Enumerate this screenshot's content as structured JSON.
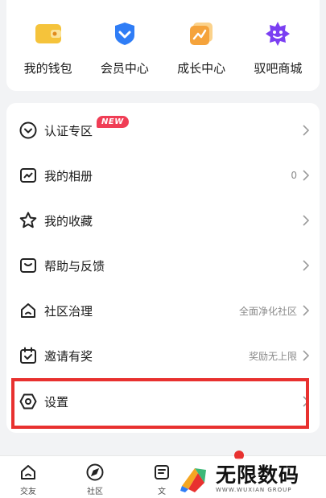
{
  "quick_entries": [
    {
      "label": "我的钱包",
      "icon": "wallet-icon"
    },
    {
      "label": "会员中心",
      "icon": "member-icon"
    },
    {
      "label": "成长中心",
      "icon": "growth-icon"
    },
    {
      "label": "驭吧商城",
      "icon": "mall-icon"
    }
  ],
  "menu": {
    "items": [
      {
        "label": "认证专区",
        "icon": "verify-icon",
        "value": "",
        "badge": "NEW"
      },
      {
        "label": "我的相册",
        "icon": "album-icon",
        "value": "0"
      },
      {
        "label": "我的收藏",
        "icon": "star-icon",
        "value": ""
      },
      {
        "label": "帮助与反馈",
        "icon": "help-icon",
        "value": ""
      },
      {
        "label": "社区治理",
        "icon": "community-icon",
        "value": "全面净化社区"
      },
      {
        "label": "邀请有奖",
        "icon": "invite-icon",
        "value": "奖励无上限"
      },
      {
        "label": "设置",
        "icon": "settings-icon",
        "value": ""
      }
    ]
  },
  "bottom_nav": [
    {
      "label": "交友",
      "icon": "friends-icon"
    },
    {
      "label": "社区",
      "icon": "compass-icon"
    },
    {
      "label": "文",
      "icon": "text-icon"
    }
  ],
  "watermark": {
    "title": "无限数码",
    "subtitle": "WWW.WUXIAN GROUP"
  },
  "colors": {
    "accent_red": "#e8312f",
    "badge": "#f03d55",
    "wallet": "#f5c33b",
    "member": "#2f7df6",
    "growth": "#f5a33b",
    "mall": "#7b3ff2"
  }
}
